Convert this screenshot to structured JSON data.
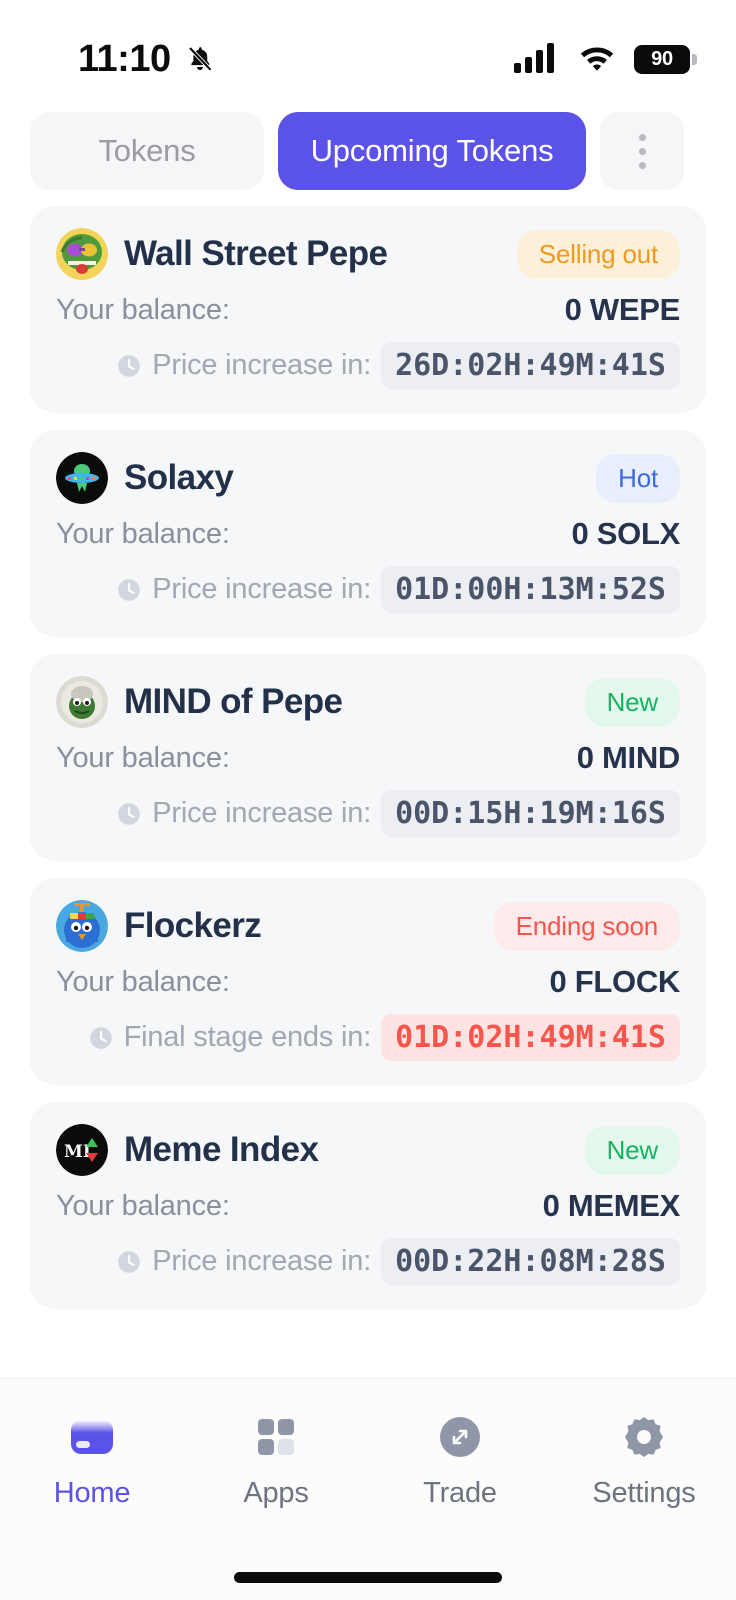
{
  "status_bar": {
    "time": "11:10",
    "battery_level": "90",
    "icons": [
      "bell-muted-icon",
      "cellular-signal-icon",
      "wifi-icon",
      "battery-icon"
    ]
  },
  "tabs": {
    "inactive_label": "Tokens",
    "active_label": "Upcoming Tokens",
    "more_label": "",
    "active_color": "#5b53e8"
  },
  "tokens": [
    {
      "name": "Wall Street Pepe",
      "badge": "Selling out",
      "badge_style": "selling",
      "balance_label": "Your balance:",
      "balance_value": "0 WEPE",
      "timer_label": "Price increase in:",
      "timer_value": "26D:02H:49M:41S",
      "timer_danger": false,
      "icon": "wall-street-pepe-avatar"
    },
    {
      "name": "Solaxy",
      "badge": "Hot",
      "badge_style": "hot",
      "balance_label": "Your balance:",
      "balance_value": "0 SOLX",
      "timer_label": "Price increase in:",
      "timer_value": "01D:00H:13M:52S",
      "timer_danger": false,
      "icon": "solaxy-avatar"
    },
    {
      "name": "MIND of Pepe",
      "badge": "New",
      "badge_style": "new",
      "balance_label": "Your balance:",
      "balance_value": "0 MIND",
      "timer_label": "Price increase in:",
      "timer_value": "00D:15H:19M:16S",
      "timer_danger": false,
      "icon": "mind-of-pepe-avatar"
    },
    {
      "name": "Flockerz",
      "badge": "Ending soon",
      "badge_style": "ending",
      "balance_label": "Your balance:",
      "balance_value": "0 FLOCK",
      "timer_label": "Final stage ends in:",
      "timer_value": "01D:02H:49M:41S",
      "timer_danger": true,
      "icon": "flockerz-avatar"
    },
    {
      "name": "Meme Index",
      "badge": "New",
      "badge_style": "new",
      "balance_label": "Your balance:",
      "balance_value": "0 MEMEX",
      "timer_label": "Price increase in:",
      "timer_value": "00D:22H:08M:28S",
      "timer_danger": false,
      "icon": "meme-index-avatar"
    }
  ],
  "bottom_nav": {
    "items": [
      {
        "label": "Home",
        "icon": "wallet-icon",
        "active": true
      },
      {
        "label": "Apps",
        "icon": "grid-icon",
        "active": false
      },
      {
        "label": "Trade",
        "icon": "expand-arrows-icon",
        "active": false
      },
      {
        "label": "Settings",
        "icon": "gear-icon",
        "active": false
      }
    ],
    "active_color": "#5b53e8"
  },
  "badge_colors": {
    "selling_out_text": "#f1981f",
    "selling_out_bg": "#fdf0d8",
    "hot_text": "#3c6ade",
    "hot_bg": "#e9eefc",
    "new_text": "#18b362",
    "new_bg": "#e2f8ec",
    "ending_soon_text": "#f7554e",
    "ending_soon_bg": "#fdeaea"
  }
}
